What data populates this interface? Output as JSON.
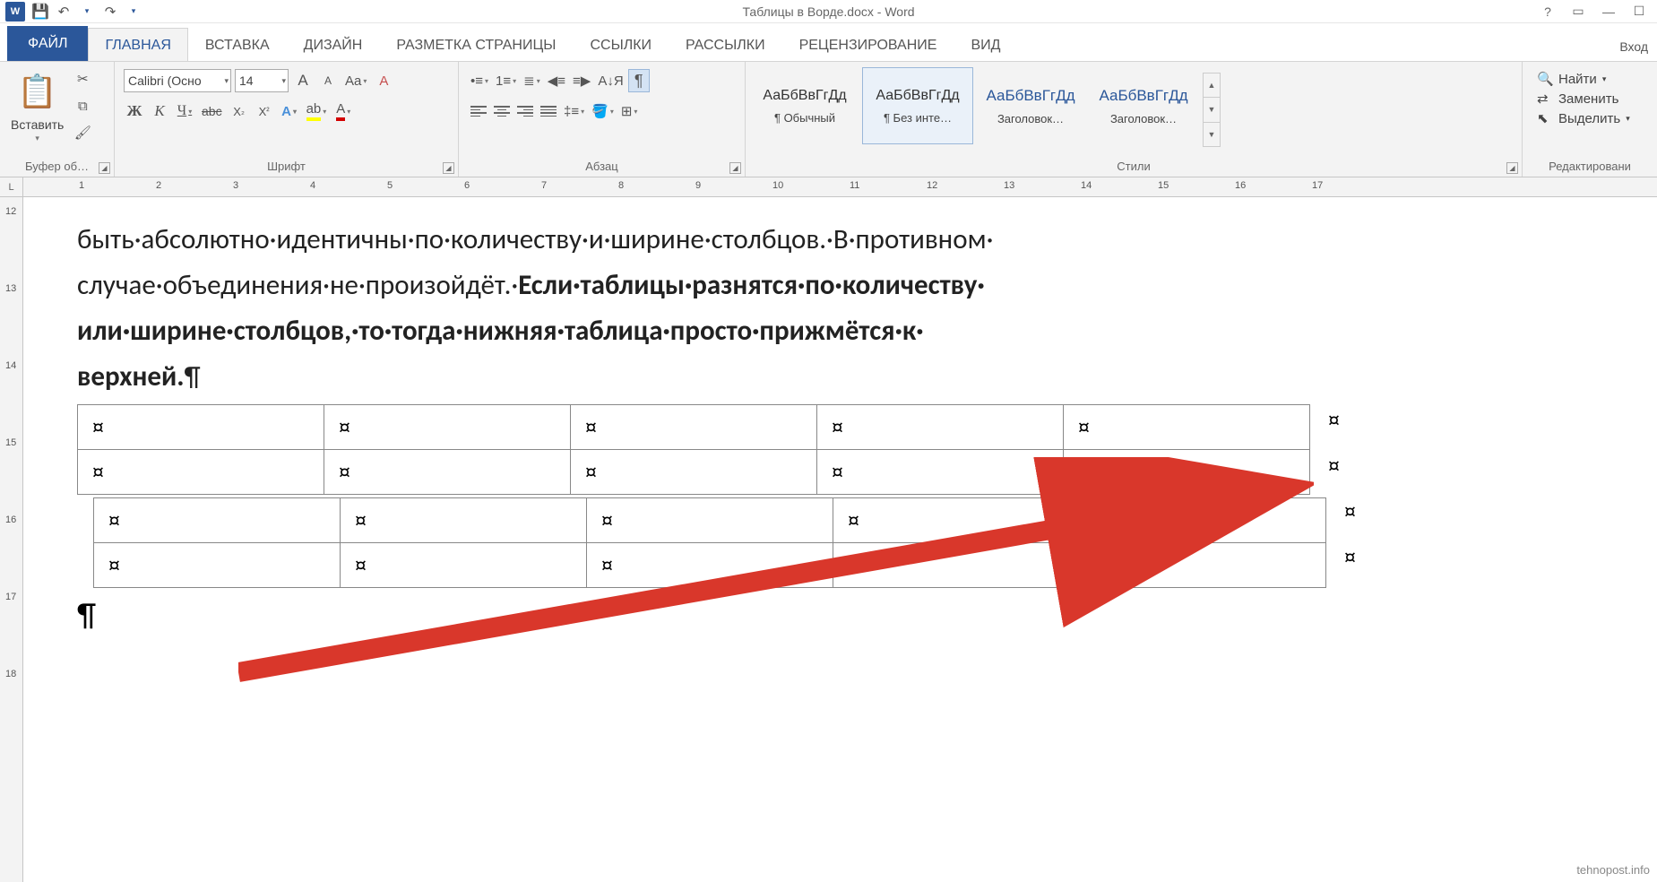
{
  "title": "Таблицы в Ворде.docx - Word",
  "qat": {
    "word": "W",
    "save": "💾",
    "undo": "↶",
    "redo": "↷"
  },
  "login": "Вход",
  "win": {
    "help": "?",
    "ribbon": "▭",
    "min": "—",
    "max": "☐"
  },
  "tabs": {
    "file": "ФАЙЛ",
    "home": "ГЛАВНАЯ",
    "insert": "ВСТАВКА",
    "design": "ДИЗАЙН",
    "layout": "РАЗМЕТКА СТРАНИЦЫ",
    "references": "ССЫЛКИ",
    "mailings": "РАССЫЛКИ",
    "review": "РЕЦЕНЗИРОВАНИЕ",
    "view": "ВИД"
  },
  "clipboard": {
    "paste": "Вставить",
    "label": "Буфер об…"
  },
  "font": {
    "name": "Calibri (Осно",
    "size": "14",
    "label": "Шрифт",
    "growA": "A",
    "shrinkA": "A",
    "case": "Aa",
    "clear": "A",
    "bold": "Ж",
    "italic": "К",
    "underline": "Ч",
    "strike": "abc",
    "sub": "X",
    "sup": "X",
    "effects": "A",
    "highlight": "ab",
    "color": "A"
  },
  "paragraph": {
    "label": "Абзац",
    "pilcrow": "¶",
    "sort": "А↓Я"
  },
  "styles": {
    "label": "Стили",
    "sample": "АаБбВвГгДд",
    "items": [
      {
        "name": "¶ Обычный",
        "heading": false
      },
      {
        "name": "¶ Без инте…",
        "heading": false
      },
      {
        "name": "Заголовок…",
        "heading": true
      },
      {
        "name": "Заголовок…",
        "heading": true
      }
    ]
  },
  "editing": {
    "label": "Редактировани",
    "find": "Найти",
    "replace": "Заменить",
    "select": "Выделить"
  },
  "ruler": {
    "corner": "L",
    "h": [
      "1",
      "2",
      "3",
      "4",
      "5",
      "6",
      "7",
      "8",
      "9",
      "10",
      "11",
      "12",
      "13",
      "14",
      "15",
      "16",
      "17"
    ],
    "v": [
      "12",
      "13",
      "14",
      "15",
      "16",
      "17",
      "18"
    ]
  },
  "document": {
    "line1": "быть·абсолютно·идентичны·по·количеству·и·ширине·столбцов.·В·противном·",
    "line2a": "случае·объединения·не·произойдёт.·",
    "line2b": "Если·таблицы·разнятся·по·количеству·",
    "line3": "или·ширине·столбцов,·то·тогда·нижняя·таблица·просто·прижмётся·к·",
    "line4": "верхней.",
    "pilcrow": "¶",
    "cellmark": "¤",
    "endpara": "¶"
  },
  "watermark": "tehnopost.info"
}
